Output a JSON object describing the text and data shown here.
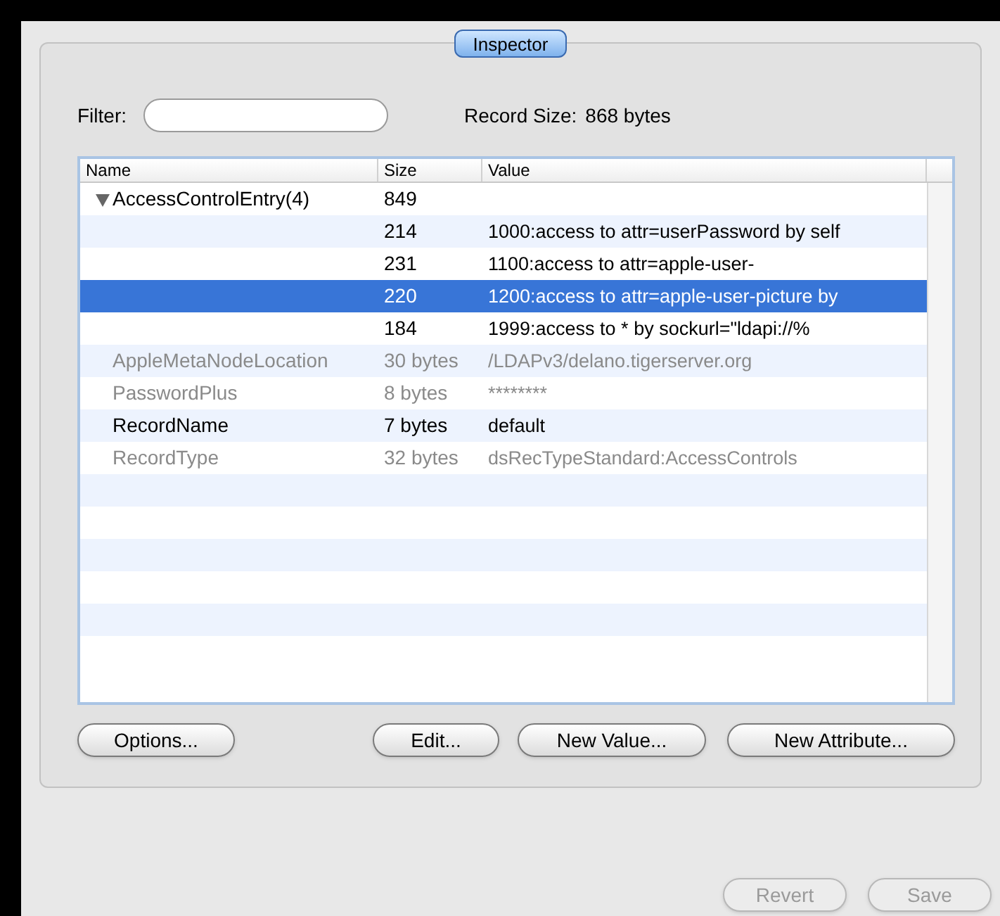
{
  "tab": {
    "label": "Inspector",
    "selected": true
  },
  "filter": {
    "label": "Filter:"
  },
  "record_size": {
    "label": "Record Size:",
    "value": "868 bytes"
  },
  "table": {
    "columns": [
      "Name",
      "Size",
      "Value"
    ],
    "rows": [
      {
        "name": "AccessControlEntry(4)",
        "size": "849",
        "expanded": true,
        "dimmed": false,
        "selected": false,
        "children": [
          {
            "size": "214",
            "value": "1000:access to attr=userPassword by self",
            "selected": false
          },
          {
            "size": "231",
            "value": "1100:access to attr=apple-user-",
            "selected": false
          },
          {
            "size": "220",
            "value": "1200:access to attr=apple-user-picture by",
            "selected": true
          },
          {
            "size": "184",
            "value": "1999:access to * by sockurl=\"ldapi://%",
            "selected": false
          }
        ]
      },
      {
        "name": "AppleMetaNodeLocation",
        "size": "30 bytes",
        "value": "/LDAPv3/delano.tigerserver.org",
        "dimmed": true,
        "selected": false
      },
      {
        "name": "PasswordPlus",
        "size": "8 bytes",
        "value": "********",
        "dimmed": true,
        "selected": false
      },
      {
        "name": "RecordName",
        "size": "7 bytes",
        "value": "default",
        "dimmed": false,
        "selected": false
      },
      {
        "name": "RecordType",
        "size": "32 bytes",
        "value": "dsRecTypeStandard:AccessControls",
        "dimmed": true,
        "selected": false
      }
    ]
  },
  "buttons": [
    {
      "label": "Options...",
      "disabled": false
    },
    {
      "label": "Edit...",
      "disabled": false
    },
    {
      "label": "New Value...",
      "disabled": false
    },
    {
      "label": "New Attribute...",
      "disabled": false
    }
  ],
  "footer_buttons": [
    {
      "label": "Revert",
      "disabled": true
    },
    {
      "label": "Save",
      "disabled": true
    }
  ]
}
